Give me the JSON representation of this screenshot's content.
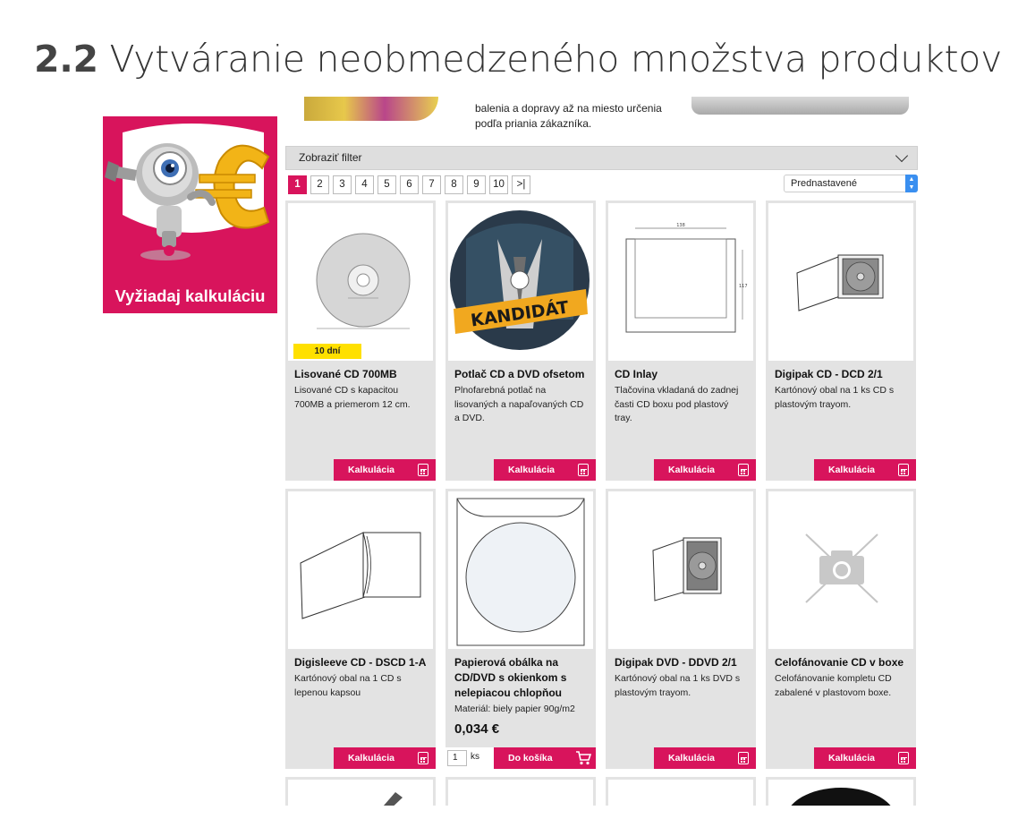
{
  "slide": {
    "number": "2.2",
    "title": "Vytváranie neobmedzeného množstva produktov"
  },
  "promo": {
    "label": "Vyžiadaj kalkuláciu",
    "background": "#d8145c"
  },
  "banner": {
    "text_line1": "balenia a dopravy až na miesto určenia",
    "text_line2": "podľa priania zákazníka."
  },
  "filter": {
    "label": "Zobraziť filter"
  },
  "pagination": {
    "pages": [
      "1",
      "2",
      "3",
      "4",
      "5",
      "6",
      "7",
      "8",
      "9",
      "10",
      ">|"
    ],
    "active": "1"
  },
  "sort": {
    "selected": "Prednastavené"
  },
  "colors": {
    "accent": "#d8145c",
    "badge": "#ffe000",
    "card_bg": "#e3e3e3",
    "select_arrow": "#3a8ff0"
  },
  "products": [
    {
      "title": "Lisované CD 700MB",
      "desc": "Lisované CD s kapacitou 700MB a priemerom 12 cm.",
      "badge": "10 dní",
      "button": "Kalkulácia",
      "image": "cd-disc-drawing"
    },
    {
      "title": "Potlač CD a DVD ofsetom",
      "desc": "Plnofarebná potlač na lisovaných a napaľovaných CD a DVD.",
      "button": "Kalkulácia",
      "image": "printed-disc-kandidat",
      "disc_text": "KANDIDÁT"
    },
    {
      "title": "CD Inlay",
      "desc": "Tlačovina vkladaná do zadnej časti CD boxu pod plastový tray.",
      "button": "Kalkulácia",
      "image": "inlay-technical-drawing",
      "dim_labels": [
        "138",
        "117"
      ]
    },
    {
      "title": "Digipak CD - DCD 2/1",
      "desc": "Kartónový obal na 1 ks CD s plastovým trayom.",
      "button": "Kalkulácia",
      "image": "digipak-cd-drawing"
    },
    {
      "title": "Digisleeve CD - DSCD 1-A",
      "desc": "Kartónový obal na 1 CD s lepenou kapsou",
      "button": "Kalkulácia",
      "image": "digisleeve-drawing"
    },
    {
      "title": "Papierová obálka na CD/DVD s okienkom s nelepiacou chlopňou",
      "desc": "Materiál: biely papier 90g/m2",
      "price": "0,034 €",
      "qty": "1",
      "unit": "ks",
      "button": "Do košíka",
      "image": "paper-envelope-drawing"
    },
    {
      "title": "Digipak DVD - DDVD 2/1",
      "desc": "Kartónový obal na 1 ks DVD s plastovým trayom.",
      "button": "Kalkulácia",
      "image": "digipak-dvd-drawing"
    },
    {
      "title": "Celofánovanie CD v boxe",
      "desc": "Celofánovanie kompletu CD zabalené v plastovom boxe.",
      "button": "Kalkulácia",
      "image": "no-image-placeholder"
    }
  ]
}
